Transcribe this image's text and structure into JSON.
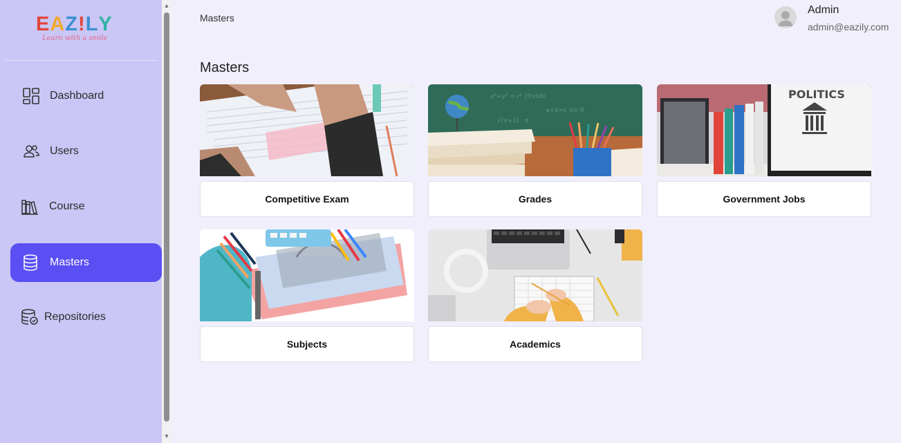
{
  "brand": {
    "letters": [
      "E",
      "A",
      "Z",
      "!",
      "L",
      "Y"
    ],
    "letter_colors": [
      "#e0453b",
      "#f0a830",
      "#3b8fd1",
      "#e0453b",
      "#3b8fd1",
      "#2fb3a3"
    ],
    "tagline": "Learn with a smile"
  },
  "sidebar": {
    "items": [
      {
        "label": "Dashboard",
        "icon": "dashboard-icon"
      },
      {
        "label": "Users",
        "icon": "users-icon"
      },
      {
        "label": "Course",
        "icon": "course-icon"
      },
      {
        "label": "Masters",
        "icon": "database-icon",
        "active": true
      },
      {
        "label": "Repositories",
        "icon": "repository-icon"
      }
    ]
  },
  "header": {
    "breadcrumb": "Masters",
    "user": {
      "name": "Admin",
      "email": "admin@eazily.com"
    }
  },
  "main": {
    "title": "Masters",
    "cards": [
      {
        "label": "Competitive Exam",
        "image": "exam-photo"
      },
      {
        "label": "Grades",
        "image": "books-chalkboard-photo"
      },
      {
        "label": "Government Jobs",
        "image": "politics-books-photo"
      },
      {
        "label": "Subjects",
        "image": "stationery-photo"
      },
      {
        "label": "Academics",
        "image": "desk-laptop-photo"
      }
    ]
  },
  "colors": {
    "sidebar_bg": "#cac6f5",
    "active_item": "#5a4ff3",
    "page_bg": "#f0effb"
  }
}
